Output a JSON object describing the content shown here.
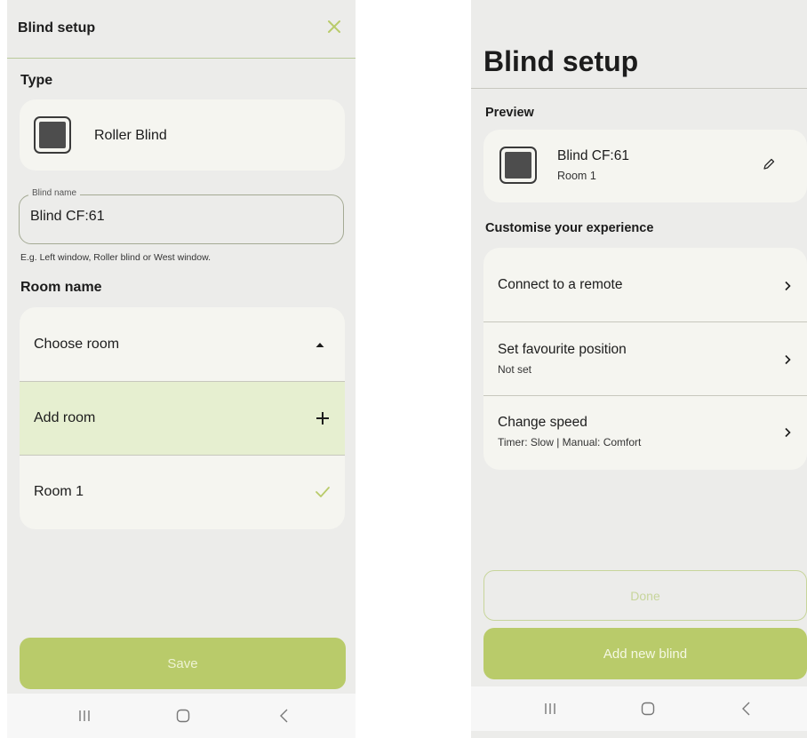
{
  "left": {
    "title": "Blind setup",
    "close_icon": "close-icon",
    "type_heading": "Type",
    "type_value": "Roller Blind",
    "blind_name_label": "Blind name",
    "blind_name_value": "Blind CF:61",
    "helper_text": "E.g. Left window, Roller blind or West window.",
    "room_heading": "Room name",
    "room_options": {
      "choose": "Choose room",
      "add": "Add room",
      "room1": "Room 1"
    },
    "save_label": "Save"
  },
  "right": {
    "title": "Blind setup",
    "preview_heading": "Preview",
    "preview_name": "Blind CF:61",
    "preview_room": "Room 1",
    "customise_heading": "Customise your experience",
    "options": [
      {
        "title": "Connect to a remote",
        "subtitle": ""
      },
      {
        "title": "Set favourite position",
        "subtitle": "Not set"
      },
      {
        "title": "Change speed",
        "subtitle": "Timer: Slow | Manual: Comfort"
      }
    ],
    "done_label": "Done",
    "add_blind_label": "Add new blind"
  },
  "colors": {
    "accent": "#b9cb6a",
    "accent_light": "#e6efd0",
    "background": "#ececea",
    "card": "#f5f5f0"
  }
}
